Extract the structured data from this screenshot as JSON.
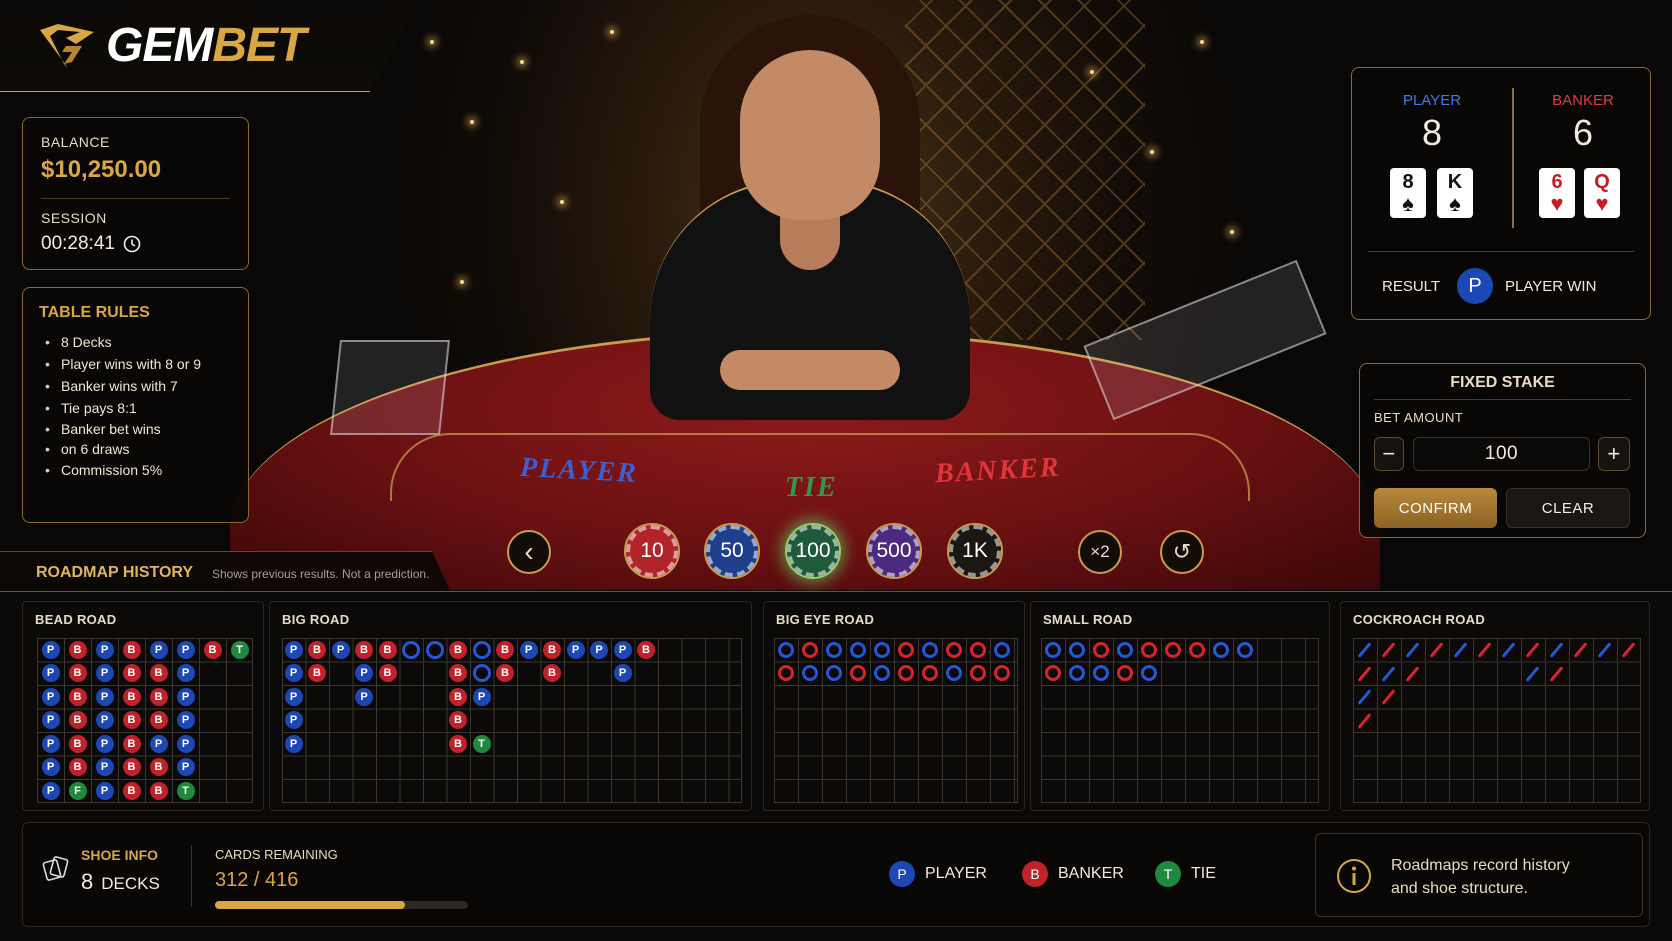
{
  "brand": {
    "name_a": "GEM",
    "name_b": "BET"
  },
  "account": {
    "balance_label": "BALANCE",
    "balance_value": "$10,250.00",
    "session_label": "SESSION",
    "session_value": "00:28:41"
  },
  "rules": {
    "title": "TABLE RULES",
    "items": [
      "8 Decks",
      "Player wins with 8 or 9",
      "Banker wins with 7",
      "Tie pays 8:1",
      "Banker bet wins",
      "on 6 draws",
      "Commission 5%"
    ]
  },
  "table_felt": {
    "player": "PLAYER",
    "tie": "TIE",
    "banker": "BANKER"
  },
  "hand": {
    "player_label": "PLAYER",
    "player_score": "8",
    "player_cards": [
      {
        "rank": "8",
        "suit": "♠"
      },
      {
        "rank": "K",
        "suit": "♠"
      }
    ],
    "banker_label": "BANKER",
    "banker_score": "6",
    "banker_cards": [
      {
        "rank": "6",
        "suit": "♥"
      },
      {
        "rank": "Q",
        "suit": "♥"
      }
    ],
    "result_label": "RESULT",
    "result_badge": "P",
    "result_text": "PLAYER WIN"
  },
  "stake": {
    "title": "FIXED STAKE",
    "amount_label": "BET AMOUNT",
    "amount_value": "100",
    "minus": "−",
    "plus": "+",
    "confirm": "CONFIRM",
    "clear": "CLEAR"
  },
  "chips": {
    "prev": "‹",
    "values": [
      "10",
      "50",
      "100",
      "500",
      "1K"
    ],
    "double": "×2",
    "undo": "↺",
    "selected": "100"
  },
  "roadmap": {
    "title": "ROADMAP HISTORY",
    "subtitle": "Shows previous results. Not a prediction.",
    "bead_title": "BEAD ROAD",
    "big_title": "BIG ROAD",
    "bigeye_title": "BIG EYE ROAD",
    "small_title": "SMALL ROAD",
    "cockroach_title": "COCKROACH ROAD",
    "bead": [
      [
        "P",
        "P",
        "P",
        "P",
        "P",
        "P",
        "P"
      ],
      [
        "B",
        "B",
        "B",
        "B",
        "B",
        "B",
        "F"
      ],
      [
        "P",
        "P",
        "P",
        "P",
        "P",
        "P",
        "P"
      ],
      [
        "B",
        "B",
        "B",
        "B",
        "B",
        "B",
        "B"
      ],
      [
        "P",
        "B",
        "B",
        "B",
        "P",
        "B",
        "B"
      ],
      [
        "P",
        "P",
        "P",
        "P",
        "P",
        "P",
        "T"
      ],
      [
        "B"
      ],
      [
        "T"
      ]
    ],
    "big": [
      {
        "c": 0,
        "r": 0,
        "v": "P"
      },
      {
        "c": 0,
        "r": 1,
        "v": "P"
      },
      {
        "c": 0,
        "r": 2,
        "v": "P"
      },
      {
        "c": 0,
        "r": 3,
        "v": "P"
      },
      {
        "c": 0,
        "r": 4,
        "v": "P"
      },
      {
        "c": 1,
        "r": 0,
        "v": "B"
      },
      {
        "c": 1,
        "r": 1,
        "v": "B"
      },
      {
        "c": 2,
        "r": 0,
        "v": "P"
      },
      {
        "c": 3,
        "r": 0,
        "v": "B"
      },
      {
        "c": 3,
        "r": 1,
        "v": "P"
      },
      {
        "c": 3,
        "r": 2,
        "v": "P"
      },
      {
        "c": 4,
        "r": 0,
        "v": "B"
      },
      {
        "c": 4,
        "r": 1,
        "v": "B"
      },
      {
        "c": 5,
        "r": 0,
        "v": "O"
      },
      {
        "c": 6,
        "r": 0,
        "v": "O"
      },
      {
        "c": 7,
        "r": 0,
        "v": "B"
      },
      {
        "c": 7,
        "r": 1,
        "v": "B"
      },
      {
        "c": 7,
        "r": 2,
        "v": "B"
      },
      {
        "c": 7,
        "r": 3,
        "v": "B"
      },
      {
        "c": 7,
        "r": 4,
        "v": "B"
      },
      {
        "c": 8,
        "r": 0,
        "v": "O"
      },
      {
        "c": 8,
        "r": 1,
        "v": "O"
      },
      {
        "c": 8,
        "r": 2,
        "v": "P"
      },
      {
        "c": 8,
        "r": 4,
        "v": "T"
      },
      {
        "c": 9,
        "r": 0,
        "v": "B"
      },
      {
        "c": 9,
        "r": 1,
        "v": "B"
      },
      {
        "c": 10,
        "r": 0,
        "v": "P"
      },
      {
        "c": 11,
        "r": 0,
        "v": "B"
      },
      {
        "c": 11,
        "r": 1,
        "v": "B"
      },
      {
        "c": 12,
        "r": 0,
        "v": "P"
      },
      {
        "c": 13,
        "r": 0,
        "v": "P"
      },
      {
        "c": 14,
        "r": 0,
        "v": "P"
      },
      {
        "c": 14,
        "r": 1,
        "v": "P"
      },
      {
        "c": 15,
        "r": 0,
        "v": "B"
      }
    ],
    "bigeye": [
      [
        "B",
        "R"
      ],
      [
        "R",
        "B"
      ],
      [
        "B",
        "B"
      ],
      [
        "B",
        "R"
      ],
      [
        "B",
        "B"
      ],
      [
        "R",
        "R"
      ],
      [
        "B",
        "R"
      ],
      [
        "R",
        "B"
      ],
      [
        "R",
        "R"
      ],
      [
        "B",
        "R"
      ]
    ],
    "small": [
      [
        "B",
        "R"
      ],
      [
        "B",
        "B"
      ],
      [
        "R",
        "B"
      ],
      [
        "B",
        "R"
      ],
      [
        "R",
        "B"
      ],
      [
        "R"
      ],
      [
        "R"
      ],
      [
        "B"
      ],
      [
        "B"
      ]
    ],
    "cockroach_cols": [
      4,
      3,
      2,
      1,
      1,
      1,
      1,
      2,
      2,
      1,
      1,
      1
    ]
  },
  "shoe": {
    "title": "SHOE INFO",
    "decks_value": "8",
    "decks_unit": "DECKS",
    "remaining_label": "CARDS REMAINING",
    "remaining_value": "312 / 416",
    "remaining_fraction": 0.75
  },
  "legend": {
    "p_badge": "P",
    "p_text": "PLAYER",
    "b_badge": "B",
    "b_text": "BANKER",
    "t_badge": "T",
    "t_text": "TIE"
  },
  "info": {
    "line1": "Roadmaps record history",
    "line2": "and shoe structure."
  },
  "colors": {
    "gold": "#d9a646",
    "player": "#1d47b5",
    "banker": "#c0222a",
    "tie": "#1f8a3d",
    "felt": "#7a1416"
  }
}
